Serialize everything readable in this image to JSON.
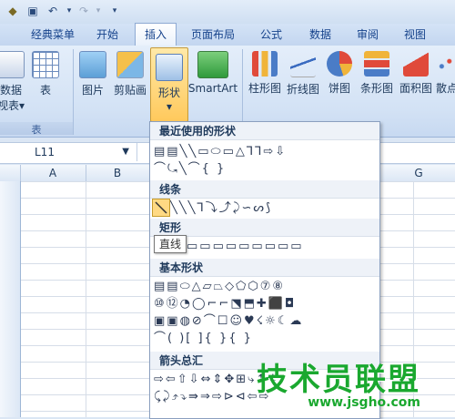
{
  "ribbon": {
    "tabs": [
      "经典菜单",
      "开始",
      "插入",
      "页面布局",
      "公式",
      "数据",
      "审阅",
      "视图"
    ],
    "active_tab": "插入",
    "buttons": {
      "table_left_line1": "数据",
      "table_left_line2": "视表",
      "table_left_arrow": "▾",
      "table": "表",
      "picture": "图片",
      "clipart": "剪贴画",
      "shapes": "形状",
      "shapes_arrow": "▾",
      "smartart": "SmartArt",
      "column_chart": "柱形图",
      "line_chart": "折线图",
      "pie_chart": "饼图",
      "bar_chart": "条形图",
      "area_chart": "面积图",
      "scatter_chart": "散点"
    },
    "groups": {
      "table": "表"
    }
  },
  "formula_bar": {
    "name_box": "L11"
  },
  "columns": [
    "A",
    "B",
    "G"
  ],
  "shapes_panel": {
    "sections": {
      "recent": "最近使用的形状",
      "lines": "线条",
      "rect": "矩形",
      "basic": "基本形状",
      "arrows": "箭头总汇"
    },
    "rows": {
      "recent1": "▤▤╲╲▭⬭▭△⅂⅂⇨⇩",
      "recent2": "⌒⤿╲⌒{ }",
      "lines1": "╲╲╲⅂⤵⤴⤸∽ᔕ⟆",
      "rect1": "▭▭▭▭▭▭▭▭▭",
      "basic1": "▤▤⬭△▱⏢◇⬠⬡⑦⑧",
      "basic2": "⑩⑫◔◯⌐⌐⬔⬒✚⬛◘",
      "basic3": "▣▣◍⊘⌒☐☺♥☇☼☾☁",
      "basic4": "⌒( )[ ]{ }{ }",
      "arrows1": "⇨⇦⇧⇩⇔⇕✥⊞⤷⇡⇣⤶",
      "arrows2": "⤹⤸⤴⤵⇛⇒⇨⊳⊲⇦⇨"
    }
  },
  "tooltip": "直线",
  "watermark": {
    "text": "技术员联盟",
    "url": "www.jsgho.com"
  },
  "colors": {
    "accent": "#15428b",
    "highlight": "#ffd983",
    "watermark": "#1aa82f"
  }
}
